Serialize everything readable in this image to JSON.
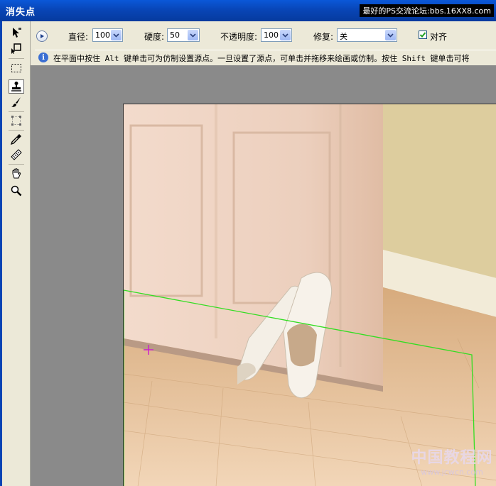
{
  "window": {
    "title": "消失点",
    "watermark": "最好的PS交流论坛:bbs.16XX8.com"
  },
  "toolbox": {
    "tools": [
      {
        "name": "edit-plane-tool-icon"
      },
      {
        "name": "create-plane-tool-icon"
      },
      {
        "name": "marquee-tool-icon"
      },
      {
        "name": "stamp-tool-icon",
        "active": true
      },
      {
        "name": "brush-tool-icon"
      },
      {
        "name": "transform-tool-icon"
      },
      {
        "name": "eyedropper-tool-icon"
      },
      {
        "name": "measure-tool-icon"
      },
      {
        "name": "hand-tool-icon"
      },
      {
        "name": "zoom-tool-icon"
      }
    ]
  },
  "options": {
    "diameter_label": "直径:",
    "diameter_value": "100",
    "hardness_label": "硬度:",
    "hardness_value": "50",
    "opacity_label": "不透明度:",
    "opacity_value": "100",
    "heal_label": "修复:",
    "heal_value": "关",
    "aligned_label": "对齐",
    "aligned_checked": true
  },
  "info": {
    "text": "在平面中按住 Alt 键单击可为仿制设置源点。一旦设置了源点，可单击并拖移来绘画或仿制。按住 Shift 键单击可将"
  },
  "watermark_bottom": {
    "cn": "中国教程网",
    "url": "www.jcwcn.com"
  },
  "colors": {
    "titlebar": "#0a58d8",
    "canvas_bg": "#8a8a8a",
    "plane_line": "#33dd22",
    "cursor": "#cc22cc"
  }
}
